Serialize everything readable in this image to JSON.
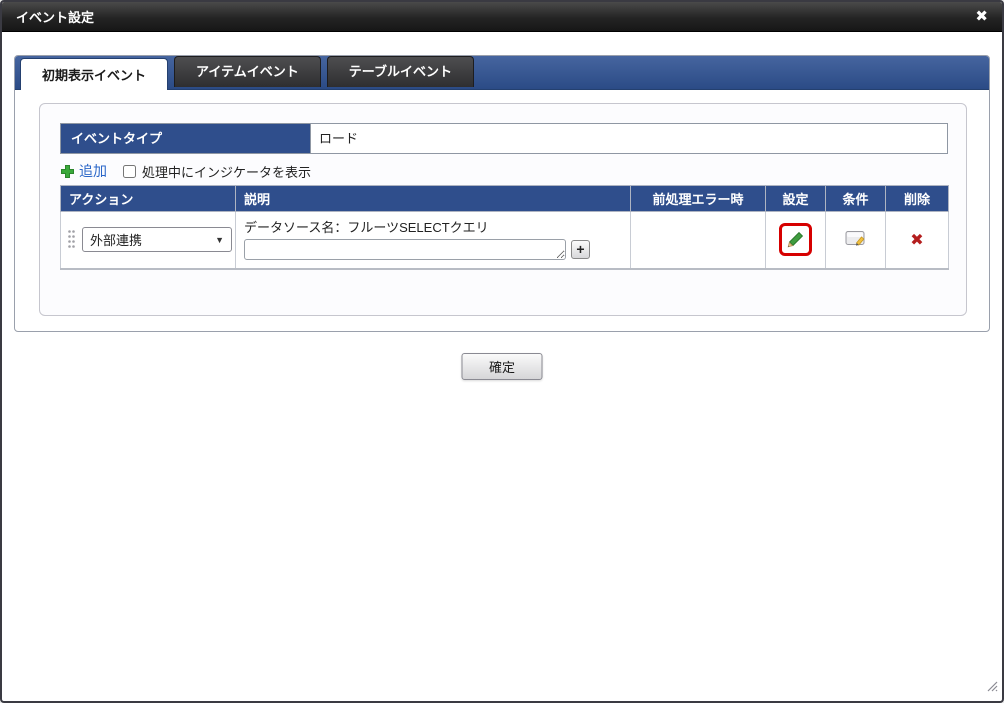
{
  "dialog": {
    "title": "イベント設定",
    "close_icon": "✖"
  },
  "tabs": [
    {
      "label": "初期表示イベント",
      "active": true
    },
    {
      "label": "アイテムイベント",
      "active": false
    },
    {
      "label": "テーブルイベント",
      "active": false
    }
  ],
  "event_type": {
    "label": "イベントタイプ",
    "value": "ロード"
  },
  "toolbar": {
    "add_label": "追加",
    "indicator_checkbox_label": "処理中にインジケータを表示",
    "indicator_checked": false
  },
  "actions_table": {
    "headers": [
      "アクション",
      "説明",
      "前処理エラー時",
      "設定",
      "条件",
      "削除"
    ],
    "rows": [
      {
        "action_selected": "外部連携",
        "description_label": "データソース名：フルーツSELECTクエリ",
        "description_input_value": "",
        "pre_error_value": "",
        "settings_icon": "pencil-icon",
        "settings_highlighted": true,
        "condition_icon": "note-edit-icon",
        "delete_icon": "✖"
      }
    ]
  },
  "footer": {
    "confirm_label": "確定"
  },
  "colors": {
    "header_blue": "#2f4e8c",
    "tabstrip_blue_top": "#46659f",
    "tabstrip_blue_bottom": "#2b4b86",
    "titlebar_dark": "#242424",
    "link_blue": "#2a66c8",
    "add_plus_green": "#3aa93a",
    "pencil_green": "#3f9c3f",
    "highlight_red": "#d60000",
    "delete_red": "#b41e1e"
  }
}
